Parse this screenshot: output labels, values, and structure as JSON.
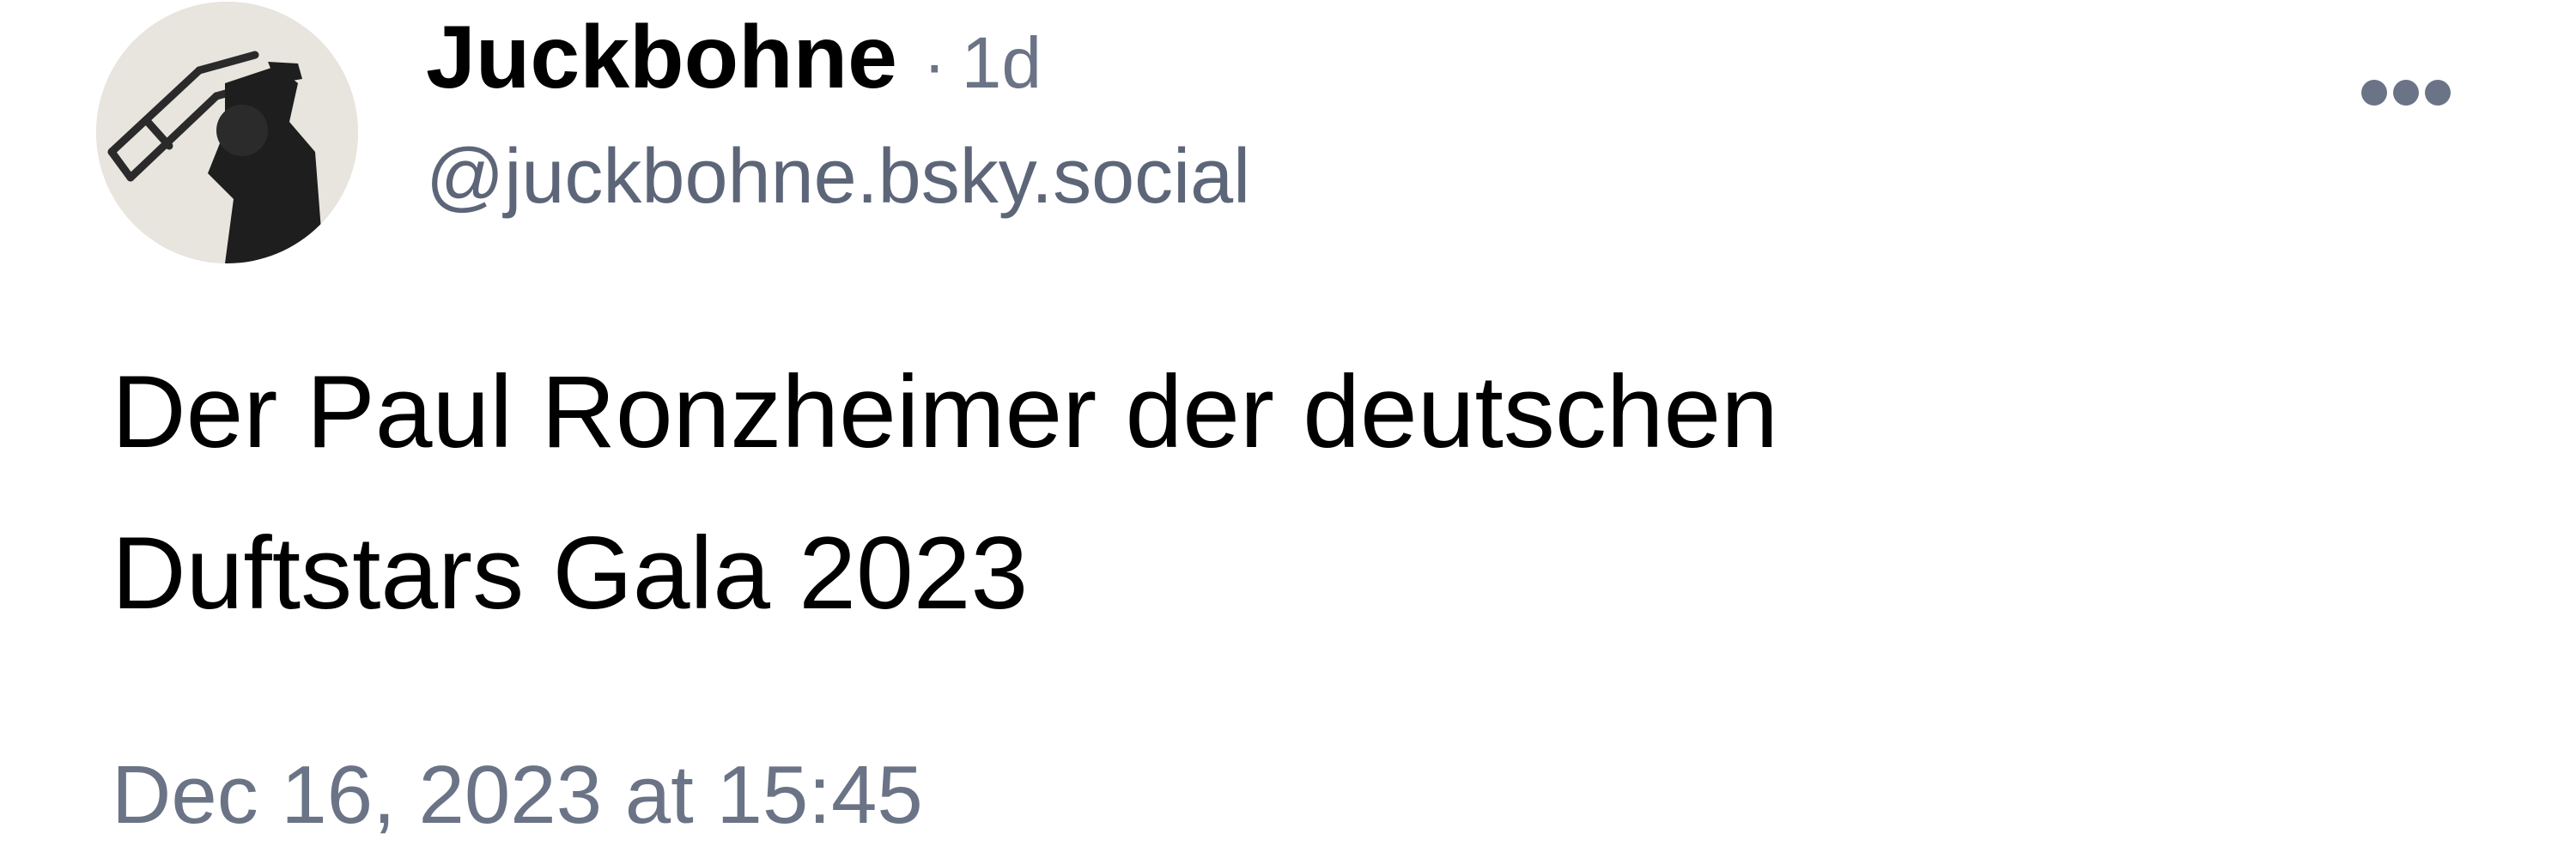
{
  "author": {
    "display_name": "Juckbohne",
    "separator": "·",
    "age": "1d",
    "handle": "@juckbohne.bsky.social"
  },
  "post": {
    "text": "Der Paul Ronzheimer der deutschen\nDuftstars Gala 2023",
    "timestamp": "Dec 16, 2023 at 15:45"
  },
  "icons": {
    "avatar": "avatar-photo",
    "more": "more-options-icon"
  },
  "colors": {
    "text_primary": "#000000",
    "text_secondary": "#6b7486",
    "icon_gray": "#6b7486",
    "background": "#ffffff"
  }
}
